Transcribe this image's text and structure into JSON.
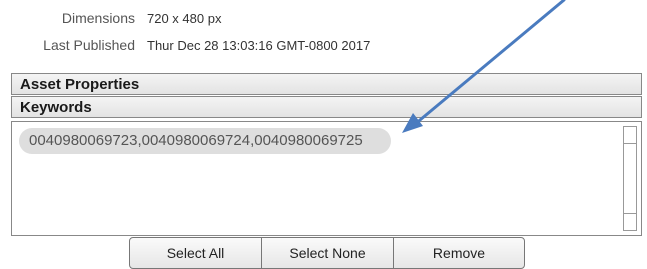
{
  "metadata": {
    "dimensions": {
      "label": "Dimensions",
      "value": "720 x 480 px"
    },
    "last_published": {
      "label": "Last Published",
      "value": "Thur  Dec 28 13:03:16 GMT-0800 2017"
    }
  },
  "panels": {
    "asset_properties": "Asset Properties",
    "keywords": "Keywords"
  },
  "keywords": {
    "value": "0040980069723,0040980069724,0040980069725"
  },
  "buttons": {
    "select_all": "Select All",
    "select_none": "Select None",
    "remove": "Remove"
  },
  "colors": {
    "arrow": "#4a7bbf",
    "chip_background": "#dedede"
  },
  "icons": {
    "annotation": "annotation-arrow-icon"
  }
}
